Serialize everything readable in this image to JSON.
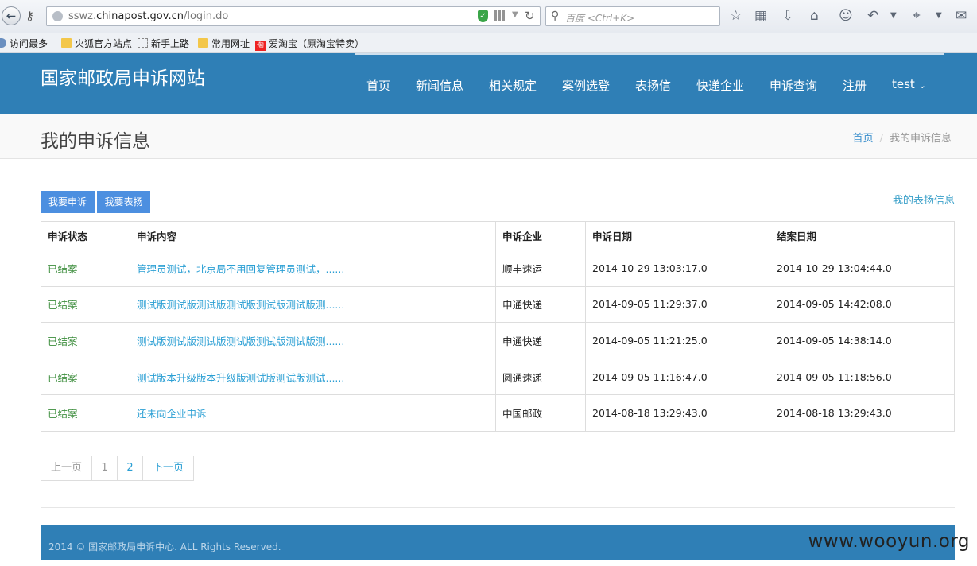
{
  "browser": {
    "url_prefix": "sswz.",
    "url_domain": "chinapost.gov.cn",
    "url_path": "/login.do",
    "search_placeholder": "百度 <Ctrl+K>",
    "bookmarks": [
      "访问最多",
      "火狐官方站点",
      "新手上路",
      "常用网址",
      "爱淘宝（原淘宝特卖）"
    ],
    "taobao_badge": "淘"
  },
  "header": {
    "site_title": "国家邮政局申诉网站",
    "nav": [
      "首页",
      "新闻信息",
      "相关规定",
      "案例选登",
      "表扬信",
      "快递企业",
      "申诉查询",
      "注册",
      "test"
    ]
  },
  "page": {
    "title": "我的申诉信息",
    "breadcrumb": [
      "首页",
      "我的申诉信息"
    ]
  },
  "actions": {
    "complain_label": "我要申诉",
    "praise_label": "我要表扬",
    "praise_info_link": "我的表扬信息"
  },
  "table": {
    "columns": [
      "申诉状态",
      "申诉内容",
      "申诉企业",
      "申诉日期",
      "结案日期"
    ],
    "rows": [
      {
        "status": "已结案",
        "content": "管理员测试，北京局不用回复管理员测试，......",
        "company": "顺丰速运",
        "filed": "2014-10-29 13:03:17.0",
        "closed": "2014-10-29 13:04:44.0"
      },
      {
        "status": "已结案",
        "content": "测试版测试版测试版测试版测试版测试版测......",
        "company": "申通快递",
        "filed": "2014-09-05 11:29:37.0",
        "closed": "2014-09-05 14:42:08.0"
      },
      {
        "status": "已结案",
        "content": "测试版测试版测试版测试版测试版测试版测......",
        "company": "申通快递",
        "filed": "2014-09-05 11:21:25.0",
        "closed": "2014-09-05 14:38:14.0"
      },
      {
        "status": "已结案",
        "content": "测试版本升级版本升级版测试版测试版测试......",
        "company": "圆通速递",
        "filed": "2014-09-05 11:16:47.0",
        "closed": "2014-09-05 11:18:56.0"
      },
      {
        "status": "已结案",
        "content": "还未向企业申诉",
        "company": "中国邮政",
        "filed": "2014-08-18 13:29:43.0",
        "closed": "2014-08-18 13:29:43.0"
      }
    ]
  },
  "pagination": {
    "prev": "上一页",
    "pages": [
      "1",
      "2"
    ],
    "next": "下一页"
  },
  "footer": {
    "copyright": "2014 © 国家邮政局申诉中心. ALL Rights Reserved."
  },
  "watermark": "www.wooyun.org"
}
